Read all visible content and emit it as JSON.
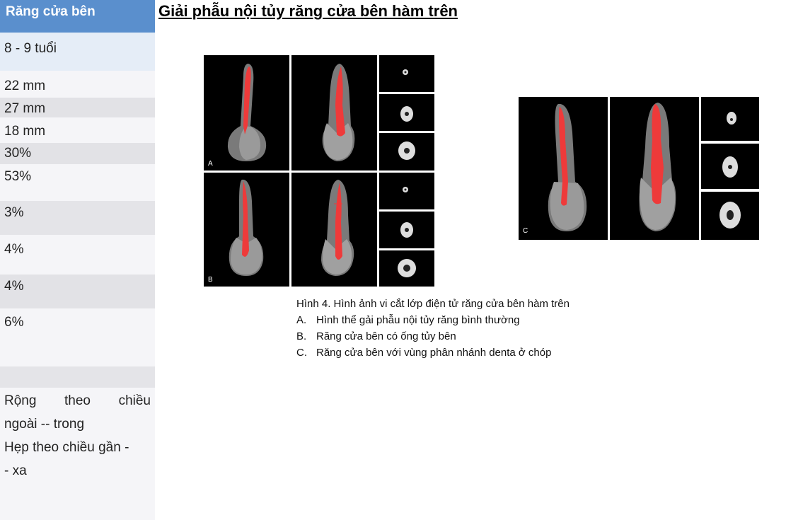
{
  "sidebar": {
    "header": "Răng cửa bên",
    "age": "8 - 9 tuổi",
    "rows": [
      "22 mm",
      "27 mm",
      "18 mm",
      "30%",
      "53%",
      "3%",
      "4%",
      "4%",
      "6%"
    ],
    "shape_text": {
      "line1": "Rộng theo chiều",
      "line2": "ngoài -- trong",
      "line3": "Hẹp theo chiều gần -",
      "line4": "- xa"
    }
  },
  "page": {
    "title": "Giải phẫu nội tủy răng cửa bên hàm trên"
  },
  "figure": {
    "labels": {
      "a": "A",
      "b": "B",
      "c": "C"
    },
    "caption": "Hình 4. Hình ảnh vi cắt lớp điện tử răng cửa bên hàm trên",
    "items": [
      {
        "key": "A.",
        "text": "Hình thể gải phẫu nội tủy răng bình thường"
      },
      {
        "key": "B.",
        "text": "Răng cửa bên có ống tủy bên"
      },
      {
        "key": "C.",
        "text": "Răng cửa bên với vùng phân nhánh denta ở chóp"
      }
    ]
  },
  "colors": {
    "header_blue": "#5a8fcd",
    "band_light": "#dfe9f5",
    "band_grey": "#e2e2e6",
    "pulp_red": "#ee3a3a",
    "tooth_grey": "#7a7a7a"
  }
}
